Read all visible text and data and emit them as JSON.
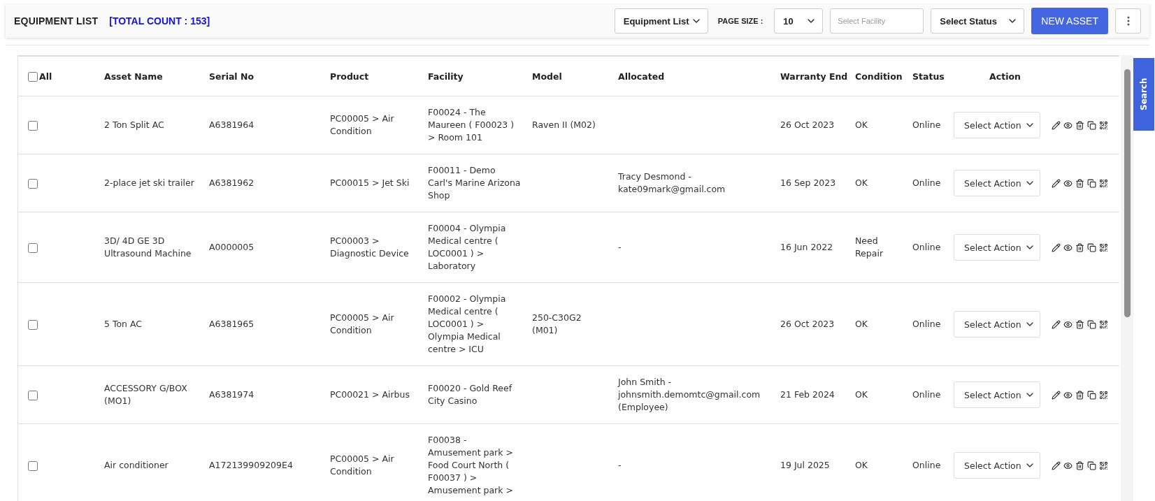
{
  "header": {
    "title": "EQUIPMENT LIST",
    "total_count": "[TOTAL COUNT : 153]",
    "view_select": "Equipment List",
    "page_size_label": "PAGE SIZE :",
    "page_size": "10",
    "facility_field": {
      "placeholder": "Select Facility"
    },
    "status_select": "Select Status",
    "new_button": "NEW ASSET"
  },
  "table": {
    "select_all": {
      "label": "All",
      "checked": false
    },
    "columns": [
      "Asset Name",
      "Serial No",
      "Product",
      "Facility",
      "Model",
      "Allocated",
      "Warranty End",
      "Condition",
      "Status",
      "Action"
    ],
    "rows": [
      {
        "checked": false,
        "asset_name": "2 Ton Split AC",
        "serial_no": "A6381964",
        "product": "PC00005 > Air Condition",
        "facility": "F00024 - The Maureen ( F00023 ) > Room 101",
        "model": "Raven II (M02)",
        "allocated": "",
        "warranty_end": "26 Oct 2023",
        "condition": "OK",
        "status": "Online",
        "action": "Select Action"
      },
      {
        "checked": false,
        "asset_name": "2-place jet ski trailer",
        "serial_no": "A6381962",
        "product": "PC00015 > Jet Ski",
        "facility": "F00011 - Demo Carl's Marine Arizona Shop",
        "model": "",
        "allocated": "Tracy Desmond - kate09mark@gmail.com",
        "warranty_end": "16 Sep 2023",
        "condition": "OK",
        "status": "Online",
        "action": "Select Action"
      },
      {
        "checked": false,
        "asset_name": "3D/ 4D GE 3D Ultrasound Machine",
        "serial_no": "A0000005",
        "product": "PC00003 > Diagnostic Device",
        "facility": "F00004 - Olympia Medical centre ( LOC0001 ) > Laboratory",
        "model": "",
        "allocated": "-",
        "warranty_end": "16 Jun 2022",
        "condition": "Need Repair",
        "status": "Online",
        "action": "Select Action"
      },
      {
        "checked": false,
        "asset_name": "5 Ton AC",
        "serial_no": "A6381965",
        "product": "PC00005 > Air Condition",
        "facility": "F00002 - Olympia Medical centre ( LOC0001 ) > Olympia Medical centre > ICU",
        "model": "250-C30G2 (M01)",
        "allocated": "",
        "warranty_end": "26 Oct 2023",
        "condition": "OK",
        "status": "Online",
        "action": "Select Action"
      },
      {
        "checked": false,
        "asset_name": "ACCESSORY G/BOX (MO1)",
        "serial_no": "A6381974",
        "product": "PC00021 > Airbus",
        "facility": "F00020 - Gold Reef City Casino",
        "model": "",
        "allocated": "John Smith - johnsmith.demomtc@gmail.com (Employee)",
        "warranty_end": "21 Feb 2024",
        "condition": "OK",
        "status": "Online",
        "action": "Select Action"
      },
      {
        "checked": false,
        "asset_name": "Air conditioner",
        "serial_no": "A172139909209E4",
        "product": "PC00005 > Air Condition",
        "facility": "F00038 - Amusement park > Food Court North ( F00037 ) > Amusement park >",
        "model": "",
        "allocated": "-",
        "warranty_end": "19 Jul 2025",
        "condition": "OK",
        "status": "Online",
        "action": "Select Action"
      }
    ]
  },
  "search_tab": "Search"
}
